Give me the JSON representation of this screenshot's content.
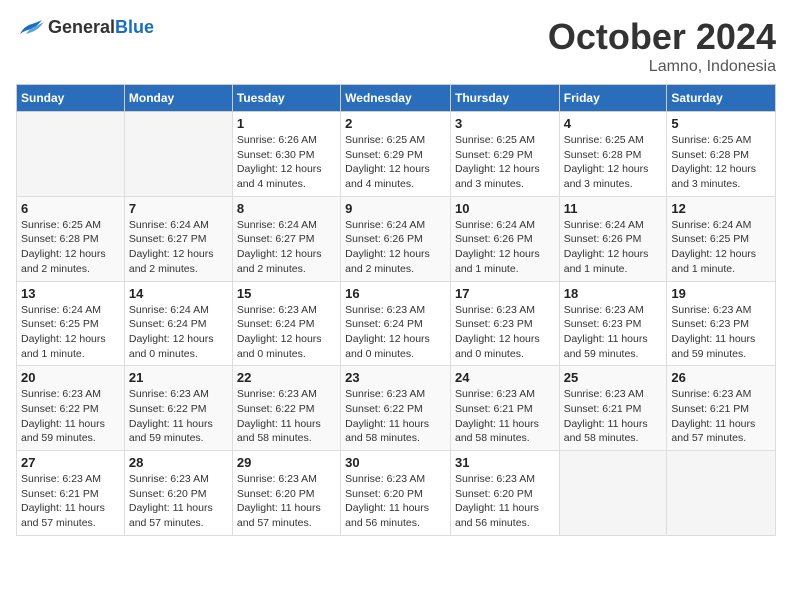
{
  "logo": {
    "general": "General",
    "blue": "Blue"
  },
  "title": "October 2024",
  "subtitle": "Lamno, Indonesia",
  "days_of_week": [
    "Sunday",
    "Monday",
    "Tuesday",
    "Wednesday",
    "Thursday",
    "Friday",
    "Saturday"
  ],
  "weeks": [
    [
      {
        "day": "",
        "detail": ""
      },
      {
        "day": "",
        "detail": ""
      },
      {
        "day": "1",
        "detail": "Sunrise: 6:26 AM\nSunset: 6:30 PM\nDaylight: 12 hours\nand 4 minutes."
      },
      {
        "day": "2",
        "detail": "Sunrise: 6:25 AM\nSunset: 6:29 PM\nDaylight: 12 hours\nand 4 minutes."
      },
      {
        "day": "3",
        "detail": "Sunrise: 6:25 AM\nSunset: 6:29 PM\nDaylight: 12 hours\nand 3 minutes."
      },
      {
        "day": "4",
        "detail": "Sunrise: 6:25 AM\nSunset: 6:28 PM\nDaylight: 12 hours\nand 3 minutes."
      },
      {
        "day": "5",
        "detail": "Sunrise: 6:25 AM\nSunset: 6:28 PM\nDaylight: 12 hours\nand 3 minutes."
      }
    ],
    [
      {
        "day": "6",
        "detail": "Sunrise: 6:25 AM\nSunset: 6:28 PM\nDaylight: 12 hours\nand 2 minutes."
      },
      {
        "day": "7",
        "detail": "Sunrise: 6:24 AM\nSunset: 6:27 PM\nDaylight: 12 hours\nand 2 minutes."
      },
      {
        "day": "8",
        "detail": "Sunrise: 6:24 AM\nSunset: 6:27 PM\nDaylight: 12 hours\nand 2 minutes."
      },
      {
        "day": "9",
        "detail": "Sunrise: 6:24 AM\nSunset: 6:26 PM\nDaylight: 12 hours\nand 2 minutes."
      },
      {
        "day": "10",
        "detail": "Sunrise: 6:24 AM\nSunset: 6:26 PM\nDaylight: 12 hours\nand 1 minute."
      },
      {
        "day": "11",
        "detail": "Sunrise: 6:24 AM\nSunset: 6:26 PM\nDaylight: 12 hours\nand 1 minute."
      },
      {
        "day": "12",
        "detail": "Sunrise: 6:24 AM\nSunset: 6:25 PM\nDaylight: 12 hours\nand 1 minute."
      }
    ],
    [
      {
        "day": "13",
        "detail": "Sunrise: 6:24 AM\nSunset: 6:25 PM\nDaylight: 12 hours\nand 1 minute."
      },
      {
        "day": "14",
        "detail": "Sunrise: 6:24 AM\nSunset: 6:24 PM\nDaylight: 12 hours\nand 0 minutes."
      },
      {
        "day": "15",
        "detail": "Sunrise: 6:23 AM\nSunset: 6:24 PM\nDaylight: 12 hours\nand 0 minutes."
      },
      {
        "day": "16",
        "detail": "Sunrise: 6:23 AM\nSunset: 6:24 PM\nDaylight: 12 hours\nand 0 minutes."
      },
      {
        "day": "17",
        "detail": "Sunrise: 6:23 AM\nSunset: 6:23 PM\nDaylight: 12 hours\nand 0 minutes."
      },
      {
        "day": "18",
        "detail": "Sunrise: 6:23 AM\nSunset: 6:23 PM\nDaylight: 11 hours\nand 59 minutes."
      },
      {
        "day": "19",
        "detail": "Sunrise: 6:23 AM\nSunset: 6:23 PM\nDaylight: 11 hours\nand 59 minutes."
      }
    ],
    [
      {
        "day": "20",
        "detail": "Sunrise: 6:23 AM\nSunset: 6:22 PM\nDaylight: 11 hours\nand 59 minutes."
      },
      {
        "day": "21",
        "detail": "Sunrise: 6:23 AM\nSunset: 6:22 PM\nDaylight: 11 hours\nand 59 minutes."
      },
      {
        "day": "22",
        "detail": "Sunrise: 6:23 AM\nSunset: 6:22 PM\nDaylight: 11 hours\nand 58 minutes."
      },
      {
        "day": "23",
        "detail": "Sunrise: 6:23 AM\nSunset: 6:22 PM\nDaylight: 11 hours\nand 58 minutes."
      },
      {
        "day": "24",
        "detail": "Sunrise: 6:23 AM\nSunset: 6:21 PM\nDaylight: 11 hours\nand 58 minutes."
      },
      {
        "day": "25",
        "detail": "Sunrise: 6:23 AM\nSunset: 6:21 PM\nDaylight: 11 hours\nand 58 minutes."
      },
      {
        "day": "26",
        "detail": "Sunrise: 6:23 AM\nSunset: 6:21 PM\nDaylight: 11 hours\nand 57 minutes."
      }
    ],
    [
      {
        "day": "27",
        "detail": "Sunrise: 6:23 AM\nSunset: 6:21 PM\nDaylight: 11 hours\nand 57 minutes."
      },
      {
        "day": "28",
        "detail": "Sunrise: 6:23 AM\nSunset: 6:20 PM\nDaylight: 11 hours\nand 57 minutes."
      },
      {
        "day": "29",
        "detail": "Sunrise: 6:23 AM\nSunset: 6:20 PM\nDaylight: 11 hours\nand 57 minutes."
      },
      {
        "day": "30",
        "detail": "Sunrise: 6:23 AM\nSunset: 6:20 PM\nDaylight: 11 hours\nand 56 minutes."
      },
      {
        "day": "31",
        "detail": "Sunrise: 6:23 AM\nSunset: 6:20 PM\nDaylight: 11 hours\nand 56 minutes."
      },
      {
        "day": "",
        "detail": ""
      },
      {
        "day": "",
        "detail": ""
      }
    ]
  ]
}
